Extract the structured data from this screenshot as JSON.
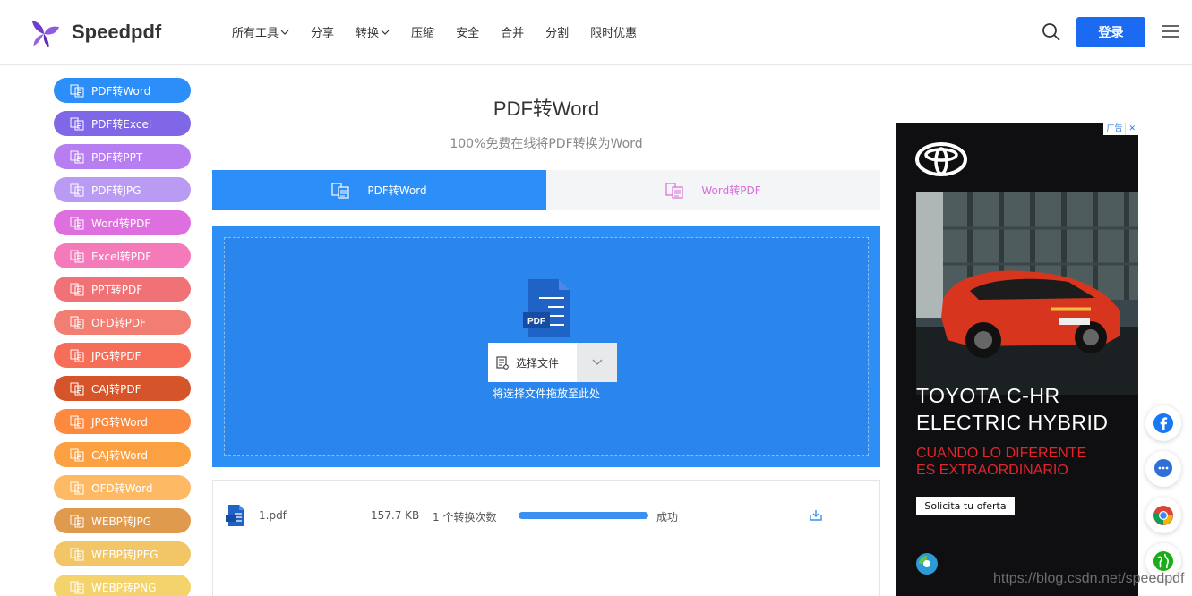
{
  "header": {
    "logo_text": "Speedpdf",
    "nav": [
      {
        "label": "所有工具",
        "has_dropdown": true
      },
      {
        "label": "分享",
        "has_dropdown": false
      },
      {
        "label": "转换",
        "has_dropdown": true
      },
      {
        "label": "压缩",
        "has_dropdown": false
      },
      {
        "label": "安全",
        "has_dropdown": false
      },
      {
        "label": "合并",
        "has_dropdown": false
      },
      {
        "label": "分割",
        "has_dropdown": false
      },
      {
        "label": "限时优惠",
        "has_dropdown": false
      }
    ],
    "login_label": "登录",
    "icons": {
      "search": "search-icon",
      "menu": "hamburger-menu-icon"
    },
    "accent_color": "#1b6bf2"
  },
  "sidebar": {
    "items": [
      {
        "label": "PDF转Word",
        "color": "#2c8ef8"
      },
      {
        "label": "PDF转Excel",
        "color": "#8067e8"
      },
      {
        "label": "PDF转PPT",
        "color": "#b67ef0"
      },
      {
        "label": "PDF转JPG",
        "color": "#b99bf4"
      },
      {
        "label": "Word转PDF",
        "color": "#dd6fde"
      },
      {
        "label": "Excel转PDF",
        "color": "#f47aba"
      },
      {
        "label": "PPT转PDF",
        "color": "#f07276"
      },
      {
        "label": "OFD转PDF",
        "color": "#f27d72"
      },
      {
        "label": "JPG转PDF",
        "color": "#f66e58"
      },
      {
        "label": "CAJ转PDF",
        "color": "#d6542a"
      },
      {
        "label": "JPG转Word",
        "color": "#fb8a3f"
      },
      {
        "label": "CAJ转Word",
        "color": "#fca141"
      },
      {
        "label": "OFD转Word",
        "color": "#fdb963"
      },
      {
        "label": "WEBP转JPG",
        "color": "#df9a4e"
      },
      {
        "label": "WEBP转JPEG",
        "color": "#f2c667"
      },
      {
        "label": "WEBP转PNG",
        "color": "#f5d36c"
      }
    ]
  },
  "main": {
    "title": "PDF转Word",
    "subtitle": "100%免费在线将PDF转换为Word",
    "tabs": [
      {
        "label": "PDF转Word",
        "active": true
      },
      {
        "label": "Word转PDF",
        "active": false
      }
    ],
    "upload": {
      "icon_label": "PDF",
      "select_label": "选择文件",
      "drop_hint": "将选择文件拖放至此处"
    },
    "files": [
      {
        "name": "1.pdf",
        "size": "157.7 KB",
        "conversions": "1 个转换次数",
        "progress": 1.0,
        "status": "成功"
      }
    ]
  },
  "ad": {
    "badge": "广告",
    "close": "✕",
    "headline_line1": "TOYOTA C-HR",
    "headline_line2": "ELECTRIC HYBRID",
    "tagline_line1": "CUANDO LO DIFERENTE",
    "tagline_line2": "ES EXTRAORDINARIO",
    "cta": "Solicita tu oferta"
  },
  "floating": [
    "facebook-icon",
    "chat-icon",
    "chrome-icon",
    "globe-share-icon"
  ],
  "watermark": "https://blog.csdn.net/speedpdf"
}
